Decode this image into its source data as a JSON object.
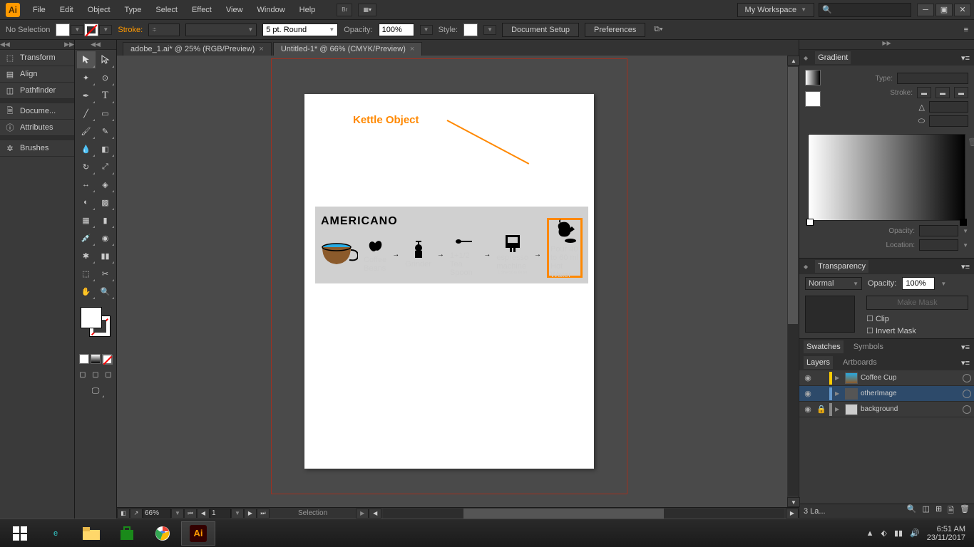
{
  "app": {
    "name": "Ai"
  },
  "menu": {
    "items": [
      "File",
      "Edit",
      "Object",
      "Type",
      "Select",
      "Effect",
      "View",
      "Window",
      "Help"
    ]
  },
  "workspace": {
    "label": "My Workspace"
  },
  "search": {
    "placeholder": ""
  },
  "controlbar": {
    "selection": "No Selection",
    "stroke_label": "Stroke:",
    "stroke_weight": "",
    "brush": "5 pt. Round",
    "opacity_label": "Opacity:",
    "opacity": "100%",
    "style_label": "Style:",
    "doc_setup": "Document Setup",
    "prefs": "Preferences"
  },
  "left_panels": {
    "items": [
      "Transform",
      "Align",
      "Pathfinder",
      "Docume...",
      "Attributes",
      "Brushes"
    ]
  },
  "tabs": [
    {
      "label": "adobe_1.ai* @ 25% (RGB/Preview)",
      "active": false
    },
    {
      "label": "Untitled-1* @ 66% (CMYK/Preview)",
      "active": true
    }
  ],
  "canvas": {
    "annotation": "Kettle Object",
    "infographic_title": "AMERICANO",
    "steps": [
      {
        "label": "Coffee Beans"
      },
      {
        "label": "Grinder"
      },
      {
        "label": "1+1/2 Tea Spoon"
      },
      {
        "label": "espresso machine",
        "sublabel": "1 Shot 50 to 60 ml"
      },
      {
        "label": "Pour 40 to 60 ml Hot Water"
      }
    ]
  },
  "statusbar": {
    "zoom": "66%",
    "page": "1",
    "tool": "Selection"
  },
  "gradient": {
    "title": "Gradient",
    "type_label": "Type:",
    "stroke_label": "Stroke:",
    "opacity_label": "Opacity:",
    "location_label": "Location:"
  },
  "transparency": {
    "title": "Transparency",
    "blend": "Normal",
    "opacity_label": "Opacity:",
    "opacity": "100%",
    "make_mask": "Make Mask",
    "clip": "Clip",
    "invert": "Invert Mask"
  },
  "swatches": {
    "tab1": "Swatches",
    "tab2": "Symbols"
  },
  "layers": {
    "tab1": "Layers",
    "tab2": "Artboards",
    "items": [
      {
        "name": "Coffee Cup",
        "color": "#ffcc00",
        "locked": false
      },
      {
        "name": "otherImage",
        "color": "#6699cc",
        "locked": false,
        "selected": true
      },
      {
        "name": "background",
        "color": "#888888",
        "locked": true
      }
    ],
    "footer": "3 La..."
  },
  "taskbar": {
    "time": "6:51 AM",
    "date": "23/11/2017"
  }
}
